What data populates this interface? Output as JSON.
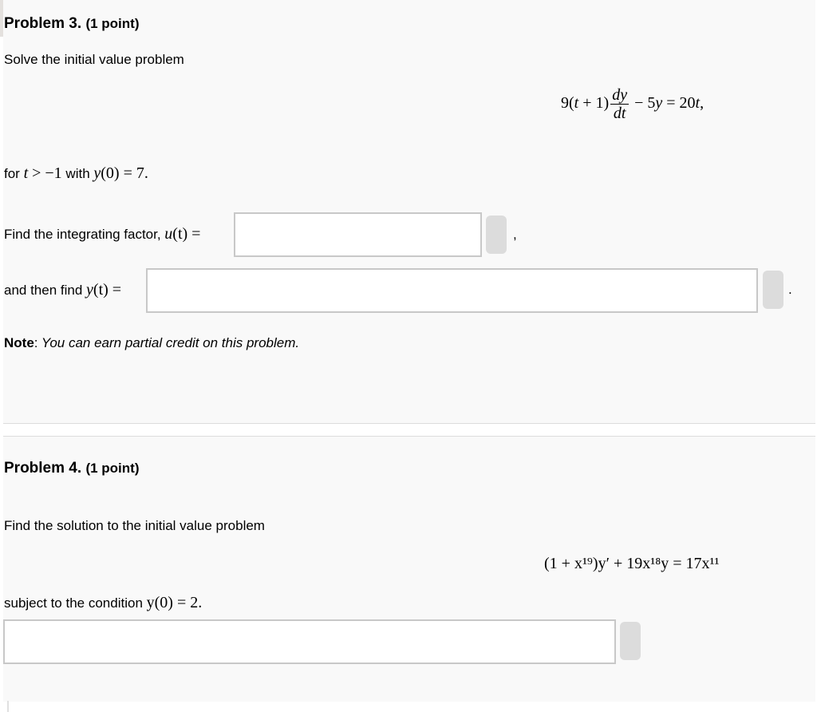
{
  "problem3": {
    "title": "Problem 3.",
    "points": "(1 point)",
    "intro": "Solve the initial value problem",
    "equation": {
      "lhs_coeff": "9(",
      "lhs_t": "t",
      "lhs_plus": " + 1)",
      "frac_num": "dy",
      "frac_den": "dt",
      "minus": " − 5",
      "y": "y",
      "equals": " = 20",
      "t": "t",
      "comma": ","
    },
    "condition": {
      "prefix": "for ",
      "t": "t",
      "gt": " > −1",
      "with": " with ",
      "y": "y",
      "rest": "(0) = 7."
    },
    "integrating_factor_label": "Find the integrating factor, ",
    "u_symbol": "u",
    "u_rest": "(t) =",
    "integrating_factor_value": "",
    "after_first_input": ",",
    "then_label": "and then find ",
    "y_symbol": "y",
    "y_rest": "(t) =",
    "solution_value": "",
    "after_second_input": ".",
    "note_label": "Note",
    "note_colon": ":",
    "note_text": " You can earn partial credit on this problem."
  },
  "problem4": {
    "title": "Problem 4.",
    "points": "(1 point)",
    "intro": "Find the solution to the initial value problem",
    "equation": "(1 + x¹⁹)y′ + 19x¹⁸y = 17x¹¹",
    "condition_prefix": "subject to the condition ",
    "condition_math": "y(0) = 2.",
    "answer_value": ""
  }
}
